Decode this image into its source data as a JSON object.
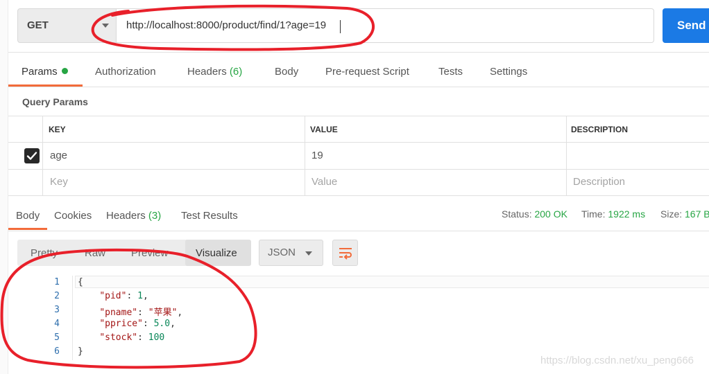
{
  "request": {
    "method": "GET",
    "url": "http://localhost:8000/product/find/1?age=19",
    "send_label": "Send"
  },
  "request_tabs": [
    {
      "label": "Params",
      "active": true,
      "dot": true
    },
    {
      "label": "Authorization"
    },
    {
      "label": "Headers",
      "count": "(6)"
    },
    {
      "label": "Body"
    },
    {
      "label": "Pre-request Script"
    },
    {
      "label": "Tests"
    },
    {
      "label": "Settings"
    }
  ],
  "query_params": {
    "title": "Query Params",
    "headers": [
      "KEY",
      "VALUE",
      "DESCRIPTION"
    ],
    "rows": [
      {
        "checked": true,
        "key": "age",
        "value": "19",
        "description": ""
      }
    ],
    "placeholders": {
      "key": "Key",
      "value": "Value",
      "description": "Description"
    }
  },
  "response_tabs": [
    {
      "label": "Body",
      "active": true
    },
    {
      "label": "Cookies"
    },
    {
      "label": "Headers",
      "count": "(3)"
    },
    {
      "label": "Test Results"
    }
  ],
  "status": {
    "status_label": "Status:",
    "status_value": "200 OK",
    "time_label": "Time:",
    "time_value": "1922 ms",
    "size_label": "Size:",
    "size_value": "167 B"
  },
  "format_tabs": [
    "Pretty",
    "Raw",
    "Preview",
    "Visualize"
  ],
  "format_selected": "Visualize",
  "language": "JSON",
  "response_body": {
    "line_numbers": [
      "1",
      "2",
      "3",
      "4",
      "5",
      "6"
    ],
    "open_brace": "{",
    "close_brace": "}",
    "fields": [
      {
        "key": "\"pid\"",
        "value": "1",
        "type": "number",
        "trail": ","
      },
      {
        "key": "\"pname\"",
        "value": "\"苹果\"",
        "type": "string",
        "trail": ","
      },
      {
        "key": "\"pprice\"",
        "value": "5.0",
        "type": "number",
        "trail": ","
      },
      {
        "key": "\"stock\"",
        "value": "100",
        "type": "number",
        "trail": ""
      }
    ]
  },
  "watermark": "https://blog.csdn.net/xu_peng666",
  "colors": {
    "accent": "#f26b3a",
    "send": "#1b7ae5",
    "success": "#27a544",
    "annotation": "#e8202a"
  }
}
